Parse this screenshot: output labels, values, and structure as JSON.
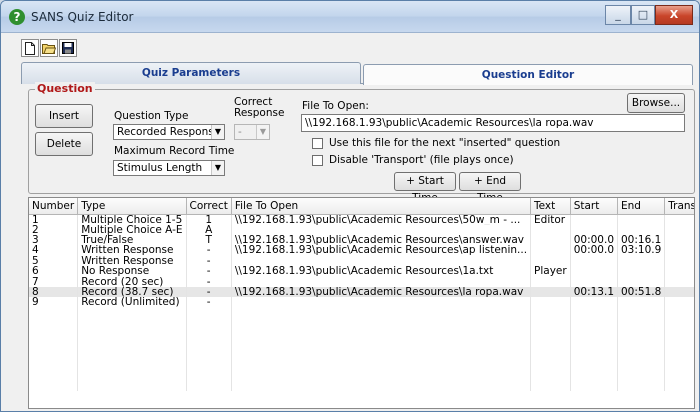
{
  "window": {
    "title": "SANS Quiz Editor",
    "controls": [
      "_",
      "□",
      "X"
    ]
  },
  "toolbar": {
    "icons": [
      "new-file-icon",
      "open-folder-icon",
      "save-icon"
    ]
  },
  "tabs": [
    {
      "label": "Quiz Parameters",
      "active": false
    },
    {
      "label": "Question Editor",
      "active": true
    }
  ],
  "question": {
    "group_title": "Question",
    "insert_label": "Insert",
    "delete_label": "Delete",
    "question_type_label": "Question Type",
    "question_type_value": "Recorded Response",
    "correct_response_label_1": "Correct",
    "correct_response_label_2": "Response",
    "correct_response_value": "-",
    "max_record_time_label": "Maximum Record Time",
    "max_record_time_value": "Stimulus Length",
    "file_to_open_label": "File To Open:",
    "file_to_open_value": "\\\\192.168.1.93\\public\\Academic Resources\\la ropa.wav",
    "browse_label": "Browse...",
    "use_file_label": "Use this file for the next \"inserted\" question",
    "use_file_checked": false,
    "disable_transport_label": "Disable 'Transport' (file plays once)",
    "disable_transport_checked": false,
    "start_time_label": "+ Start Time",
    "end_time_label": "+ End Time"
  },
  "table": {
    "columns": [
      "Number",
      "Type",
      "Correct",
      "File To Open",
      "Text",
      "Start",
      "End",
      "Transport"
    ],
    "rows": [
      [
        "1",
        "Multiple Choice 1-5",
        "1",
        "\\\\192.168.1.93\\public\\Academic Resources\\50w_m - ...",
        "Editor",
        "",
        "",
        ""
      ],
      [
        "2",
        "Multiple Choice A-E",
        "A",
        "",
        "",
        "",
        "",
        ""
      ],
      [
        "3",
        "True/False",
        "T",
        "\\\\192.168.1.93\\public\\Academic Resources\\answer.wav",
        "",
        "00:00.0",
        "00:16.1",
        ""
      ],
      [
        "4",
        "Written Response",
        "-",
        "\\\\192.168.1.93\\public\\Academic Resources\\ap listenin...",
        "",
        "00:00.0",
        "03:10.9",
        ""
      ],
      [
        "5",
        "Written Response",
        "-",
        "",
        "",
        "",
        "",
        ""
      ],
      [
        "6",
        "No Response",
        "-",
        "\\\\192.168.1.93\\public\\Academic Resources\\1a.txt",
        "Player",
        "",
        "",
        ""
      ],
      [
        "7",
        "Record (20 sec)",
        "-",
        "",
        "",
        "",
        "",
        ""
      ],
      [
        "8",
        "Record (38.7 sec)",
        "-",
        "\\\\192.168.1.93\\public\\Academic Resources\\la ropa.wav",
        "",
        "00:13.1",
        "00:51.8",
        ""
      ],
      [
        "9",
        "Record (Unlimited)",
        "-",
        "",
        "",
        "",
        "",
        ""
      ]
    ],
    "selected_row": 7
  }
}
